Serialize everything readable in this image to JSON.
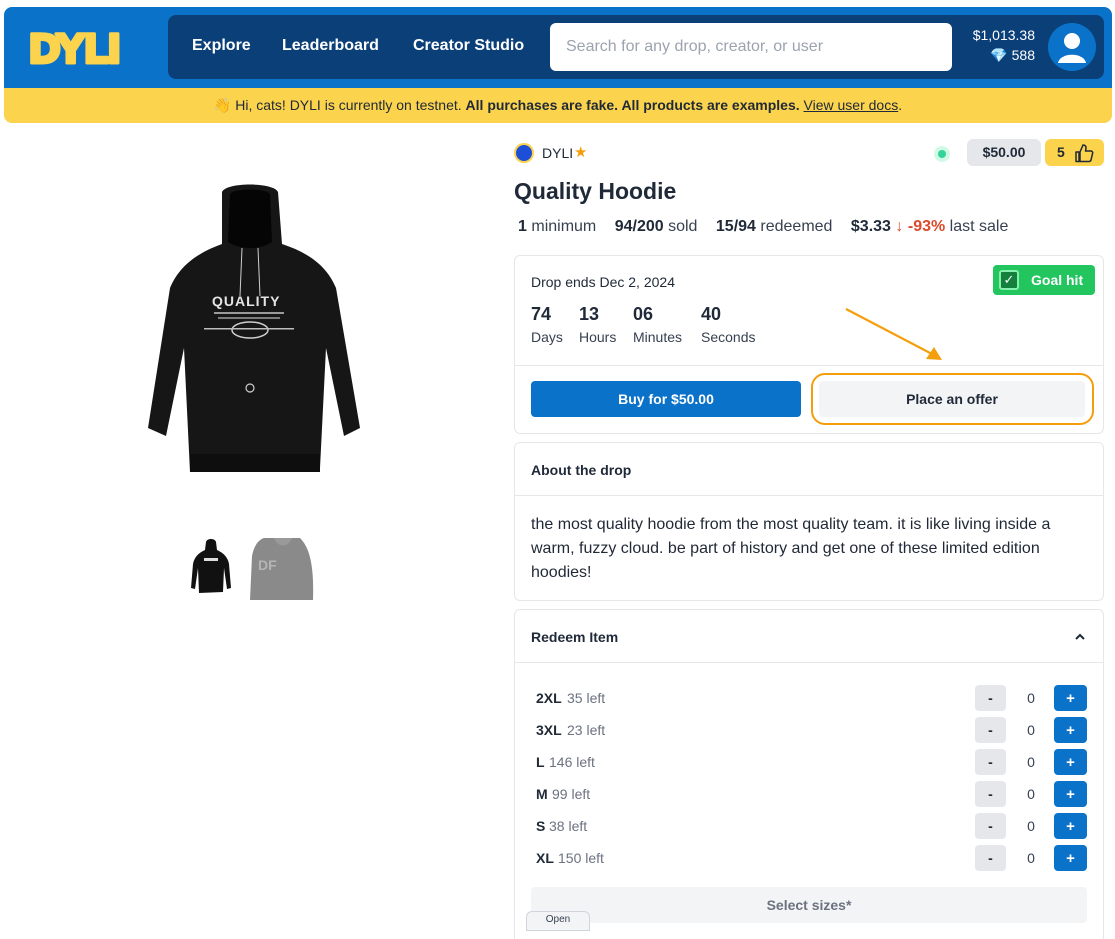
{
  "header": {
    "logo_text": "DYLI",
    "nav": [
      "Explore",
      "Leaderboard",
      "Creator Studio"
    ],
    "search_placeholder": "Search for any drop, creator, or user",
    "balance": "$1,013.38",
    "gems": "588"
  },
  "banner": {
    "wave": "👋",
    "prefix": "Hi, cats! DYLI is currently on testnet.",
    "bold": "All purchases are fake. All products are examples.",
    "link": "View user docs",
    "suffix": "."
  },
  "product": {
    "creator": "DYLI",
    "price": "$50.00",
    "likes": "5",
    "title": "Quality Hoodie",
    "stats": {
      "minimum_num": "1",
      "minimum_lbl": "minimum",
      "sold_num": "94/200",
      "sold_lbl": "sold",
      "redeemed_num": "15/94",
      "redeemed_lbl": "redeemed",
      "last_price": "$3.33",
      "arrow": "↓",
      "change": "-93%",
      "last_lbl": "last sale"
    }
  },
  "drop": {
    "ends": "Drop ends Dec 2, 2024",
    "goal": "Goal hit",
    "countdown": [
      {
        "num": "74",
        "label": "Days"
      },
      {
        "num": "13",
        "label": "Hours"
      },
      {
        "num": "06",
        "label": "Minutes"
      },
      {
        "num": "40",
        "label": "Seconds"
      }
    ],
    "buy_label": "Buy for $50.00",
    "offer_label": "Place an offer"
  },
  "about": {
    "heading": "About the drop",
    "text": "the most quality hoodie from the most quality team. it is like living inside a warm, fuzzy cloud. be part of history and get one of these limited edition hoodies!"
  },
  "redeem": {
    "heading": "Redeem Item",
    "sizes": [
      {
        "size": "2XL",
        "left": "35 left",
        "qty": "0"
      },
      {
        "size": "3XL",
        "left": "23 left",
        "qty": "0"
      },
      {
        "size": "L",
        "left": "146 left",
        "qty": "0"
      },
      {
        "size": "M",
        "left": "99 left",
        "qty": "0"
      },
      {
        "size": "S",
        "left": "38 left",
        "qty": "0"
      },
      {
        "size": "XL",
        "left": "150 left",
        "qty": "0"
      }
    ],
    "minus": "-",
    "plus": "+",
    "select_label": "Select sizes*"
  },
  "open_tab": "Open",
  "colors": {
    "brand_blue": "#0a72c8",
    "nav_dark": "#0b3f78",
    "banner_yellow": "#fcd34d",
    "goal_green": "#22c55e",
    "highlight_orange": "#f59e0b",
    "down_red": "#dc4a2b"
  }
}
